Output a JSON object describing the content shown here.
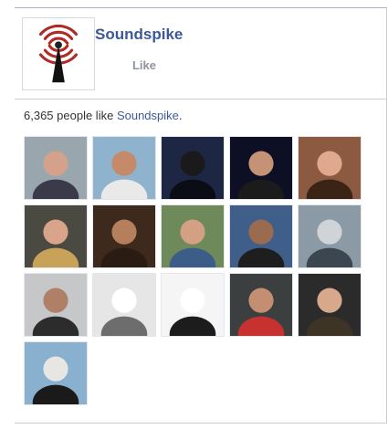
{
  "page": {
    "name": "Soundspike",
    "like_label": "Like",
    "fan_count": "6,365",
    "people_like_text": " people like ",
    "period": "."
  },
  "colors": {
    "link": "#3b5998",
    "logo_red": "#b22a26"
  },
  "faces": [
    {
      "label": "fan-1",
      "bg": "#9aa6ad",
      "fg": "#3b3a4a",
      "skin": "#d4a28b"
    },
    {
      "label": "fan-2",
      "bg": "#8fb3cc",
      "fg": "#e9e9ea",
      "skin": "#c48a6a"
    },
    {
      "label": "fan-3",
      "bg": "#1d2744",
      "fg": "#0b0d16",
      "skin": "#1a1a1a"
    },
    {
      "label": "fan-4",
      "bg": "#0d0f24",
      "fg": "#1b1b1b",
      "skin": "#c59276"
    },
    {
      "label": "fan-5",
      "bg": "#8c5a41",
      "fg": "#3b2416",
      "skin": "#e0a98d"
    },
    {
      "label": "fan-6",
      "bg": "#4a4a42",
      "fg": "#c9a25a",
      "skin": "#d9a48a"
    },
    {
      "label": "fan-7",
      "bg": "#3e2a1d",
      "fg": "#2a1c12",
      "skin": "#b57f5d"
    },
    {
      "label": "fan-8",
      "bg": "#6f8a5a",
      "fg": "#3c5d88",
      "skin": "#d4a084"
    },
    {
      "label": "fan-9",
      "bg": "#3f5f8a",
      "fg": "#1e1e1e",
      "skin": "#9b6b4f"
    },
    {
      "label": "fan-10",
      "bg": "#8b9aa5",
      "fg": "#3b4650",
      "skin": "#cfd4d8"
    },
    {
      "label": "fan-11",
      "bg": "#c5c7c8",
      "fg": "#2c2c2c",
      "skin": "#b07f68"
    },
    {
      "label": "fan-12",
      "bg": "#e6e6e6",
      "fg": "#6d6d6d",
      "skin": "#ffffff"
    },
    {
      "label": "fan-13",
      "bg": "#f5f5f5",
      "fg": "#1c1c1c",
      "skin": "#ffffff"
    },
    {
      "label": "fan-14",
      "bg": "#3b3f3f",
      "fg": "#c7312f",
      "skin": "#c38e72"
    },
    {
      "label": "fan-15",
      "bg": "#2b2b2b",
      "fg": "#3d3426",
      "skin": "#d8a88d"
    },
    {
      "label": "fan-16",
      "bg": "#8ab0cf",
      "fg": "#1a1a1a",
      "skin": "#e8e6e2"
    }
  ]
}
